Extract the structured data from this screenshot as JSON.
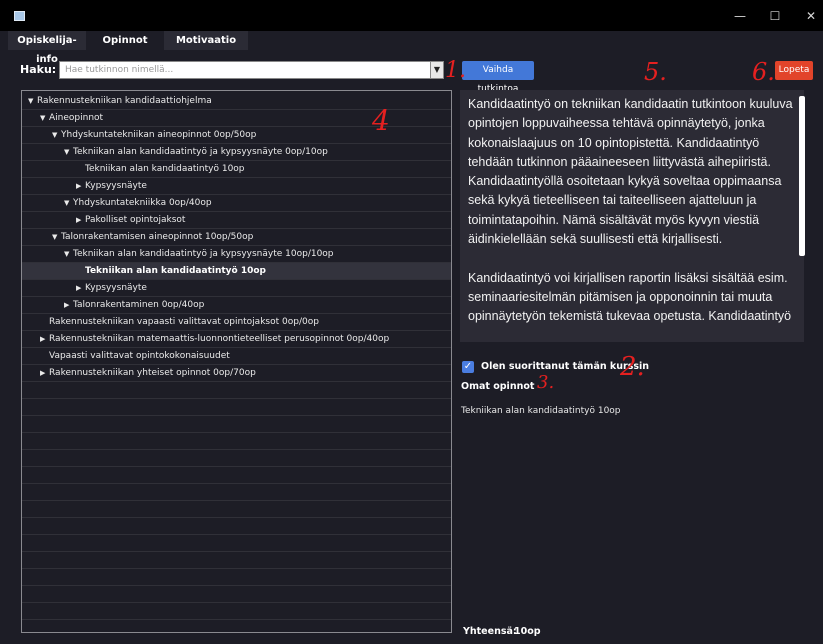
{
  "window": {
    "controls": {
      "minimize": "—",
      "maximize": "☐",
      "close": "✕"
    }
  },
  "tabs": [
    {
      "label": "Opiskelija-info"
    },
    {
      "label": "Opinnot"
    },
    {
      "label": "Motivaatio"
    }
  ],
  "search": {
    "label": "Haku:",
    "placeholder": "Hae tutkinnon nimellä...",
    "dropdown_glyph": "▼"
  },
  "buttons": {
    "change_degree": "Vaihda tutkintoa",
    "quit": "Lopeta"
  },
  "tree": [
    {
      "label": "Rakennustekniikan kandidaattiohjelma",
      "depth": 0,
      "arrow": "▼"
    },
    {
      "label": "Aineopinnot",
      "depth": 1,
      "arrow": "▼"
    },
    {
      "label": "Yhdyskuntatekniikan aineopinnot 0op/50op",
      "depth": 2,
      "arrow": "▼"
    },
    {
      "label": "Tekniikan alan kandidaatintyö ja kypsyysnäyte 0op/10op",
      "depth": 3,
      "arrow": "▼"
    },
    {
      "label": "Tekniikan alan kandidaatintyö 10op",
      "depth": 4,
      "arrow": ""
    },
    {
      "label": "Kypsyysnäyte",
      "depth": 4,
      "arrow": "▶"
    },
    {
      "label": "Yhdyskuntatekniikka 0op/40op",
      "depth": 3,
      "arrow": "▼"
    },
    {
      "label": "Pakolliset opintojaksot",
      "depth": 4,
      "arrow": "▶"
    },
    {
      "label": "Talonrakentamisen aineopinnot 10op/50op",
      "depth": 2,
      "arrow": "▼"
    },
    {
      "label": "Tekniikan alan kandidaatintyö ja kypsyysnäyte 10op/10op",
      "depth": 3,
      "arrow": "▼"
    },
    {
      "label": "Tekniikan alan kandidaatintyö 10op",
      "depth": 4,
      "arrow": "",
      "selected": true
    },
    {
      "label": "Kypsyysnäyte",
      "depth": 4,
      "arrow": "▶"
    },
    {
      "label": "Talonrakentaminen 0op/40op",
      "depth": 3,
      "arrow": "▶"
    },
    {
      "label": "Rakennustekniikan vapaasti valittavat opintojaksot 0op/0op",
      "depth": 1,
      "arrow": ""
    },
    {
      "label": "Rakennustekniikan matemaattis-luonnontieteelliset perusopinnot 0op/40op",
      "depth": 1,
      "arrow": "▶"
    },
    {
      "label": "Vapaasti valittavat opintokokonaisuudet",
      "depth": 1,
      "arrow": ""
    },
    {
      "label": "Rakennustekniikan yhteiset opinnot 0op/70op",
      "depth": 1,
      "arrow": "▶"
    }
  ],
  "description": {
    "paragraphs": [
      "Kandidaatintyö on tekniikan kandidaatin tutkintoon kuuluva opintojen loppuvaiheessa tehtävä opinnäytetyö, jonka kokonaislaajuus on 10 opintopistettä. Kandidaatintyö tehdään tutkinnon pääaineeseen liittyvästä aihepiiristä. Kandidaatintyöllä osoitetaan kykyä soveltaa oppimaansa sekä kykyä tieteelliseen tai taiteelliseen ajatteluun ja toimintatapoihin. Nämä sisältävät myös kyvyn viestiä äidinkielellään sekä suullisesti että kirjallisesti.",
      "Kandidaatintyö voi kirjallisen raportin lisäksi sisältää esim. seminaariesitelmän pitämisen ja opponoinnin tai muuta opinnäytetyön tekemistä tukevaa opetusta. Kandidaatintyö"
    ]
  },
  "completed": {
    "label": "Olen suorittanut tämän kurssin",
    "checked": true,
    "glyph": "✓"
  },
  "own_studies": {
    "title": "Omat opinnot",
    "items": [
      "Tekniikan alan kandidaatintyö 10op"
    ]
  },
  "total": {
    "label": "Yhteensä:",
    "value": "10op"
  },
  "annotations": [
    "1.",
    "2.",
    "3.",
    "4",
    "5.",
    "6."
  ],
  "colors": {
    "accent": "#4378d8",
    "danger": "#e2442a",
    "annotation": "#e52020",
    "background": "#1d1d26"
  }
}
